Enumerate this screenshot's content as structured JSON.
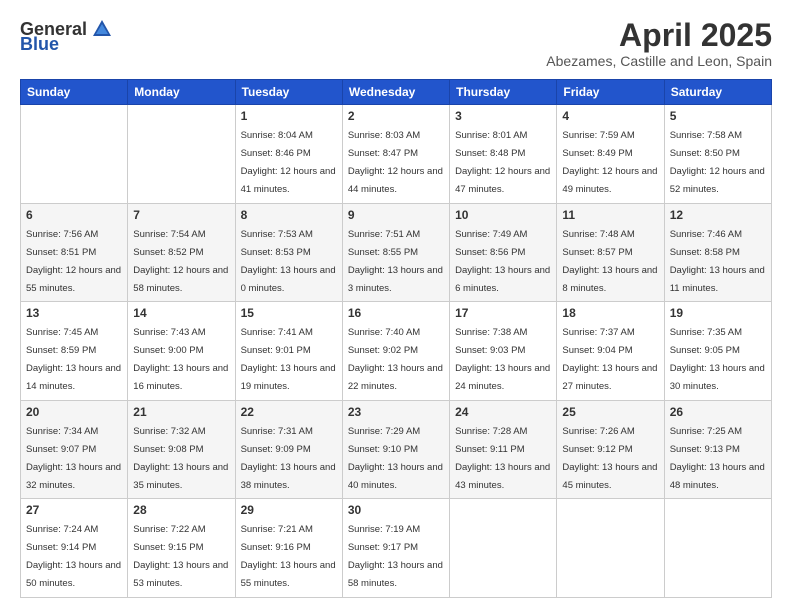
{
  "header": {
    "logo_general": "General",
    "logo_blue": "Blue",
    "month_title": "April 2025",
    "location": "Abezames, Castille and Leon, Spain"
  },
  "weekdays": [
    "Sunday",
    "Monday",
    "Tuesday",
    "Wednesday",
    "Thursday",
    "Friday",
    "Saturday"
  ],
  "weeks": [
    [
      {
        "day": "",
        "sunrise": "",
        "sunset": "",
        "daylight": ""
      },
      {
        "day": "",
        "sunrise": "",
        "sunset": "",
        "daylight": ""
      },
      {
        "day": "1",
        "sunrise": "Sunrise: 8:04 AM",
        "sunset": "Sunset: 8:46 PM",
        "daylight": "Daylight: 12 hours and 41 minutes."
      },
      {
        "day": "2",
        "sunrise": "Sunrise: 8:03 AM",
        "sunset": "Sunset: 8:47 PM",
        "daylight": "Daylight: 12 hours and 44 minutes."
      },
      {
        "day": "3",
        "sunrise": "Sunrise: 8:01 AM",
        "sunset": "Sunset: 8:48 PM",
        "daylight": "Daylight: 12 hours and 47 minutes."
      },
      {
        "day": "4",
        "sunrise": "Sunrise: 7:59 AM",
        "sunset": "Sunset: 8:49 PM",
        "daylight": "Daylight: 12 hours and 49 minutes."
      },
      {
        "day": "5",
        "sunrise": "Sunrise: 7:58 AM",
        "sunset": "Sunset: 8:50 PM",
        "daylight": "Daylight: 12 hours and 52 minutes."
      }
    ],
    [
      {
        "day": "6",
        "sunrise": "Sunrise: 7:56 AM",
        "sunset": "Sunset: 8:51 PM",
        "daylight": "Daylight: 12 hours and 55 minutes."
      },
      {
        "day": "7",
        "sunrise": "Sunrise: 7:54 AM",
        "sunset": "Sunset: 8:52 PM",
        "daylight": "Daylight: 12 hours and 58 minutes."
      },
      {
        "day": "8",
        "sunrise": "Sunrise: 7:53 AM",
        "sunset": "Sunset: 8:53 PM",
        "daylight": "Daylight: 13 hours and 0 minutes."
      },
      {
        "day": "9",
        "sunrise": "Sunrise: 7:51 AM",
        "sunset": "Sunset: 8:55 PM",
        "daylight": "Daylight: 13 hours and 3 minutes."
      },
      {
        "day": "10",
        "sunrise": "Sunrise: 7:49 AM",
        "sunset": "Sunset: 8:56 PM",
        "daylight": "Daylight: 13 hours and 6 minutes."
      },
      {
        "day": "11",
        "sunrise": "Sunrise: 7:48 AM",
        "sunset": "Sunset: 8:57 PM",
        "daylight": "Daylight: 13 hours and 8 minutes."
      },
      {
        "day": "12",
        "sunrise": "Sunrise: 7:46 AM",
        "sunset": "Sunset: 8:58 PM",
        "daylight": "Daylight: 13 hours and 11 minutes."
      }
    ],
    [
      {
        "day": "13",
        "sunrise": "Sunrise: 7:45 AM",
        "sunset": "Sunset: 8:59 PM",
        "daylight": "Daylight: 13 hours and 14 minutes."
      },
      {
        "day": "14",
        "sunrise": "Sunrise: 7:43 AM",
        "sunset": "Sunset: 9:00 PM",
        "daylight": "Daylight: 13 hours and 16 minutes."
      },
      {
        "day": "15",
        "sunrise": "Sunrise: 7:41 AM",
        "sunset": "Sunset: 9:01 PM",
        "daylight": "Daylight: 13 hours and 19 minutes."
      },
      {
        "day": "16",
        "sunrise": "Sunrise: 7:40 AM",
        "sunset": "Sunset: 9:02 PM",
        "daylight": "Daylight: 13 hours and 22 minutes."
      },
      {
        "day": "17",
        "sunrise": "Sunrise: 7:38 AM",
        "sunset": "Sunset: 9:03 PM",
        "daylight": "Daylight: 13 hours and 24 minutes."
      },
      {
        "day": "18",
        "sunrise": "Sunrise: 7:37 AM",
        "sunset": "Sunset: 9:04 PM",
        "daylight": "Daylight: 13 hours and 27 minutes."
      },
      {
        "day": "19",
        "sunrise": "Sunrise: 7:35 AM",
        "sunset": "Sunset: 9:05 PM",
        "daylight": "Daylight: 13 hours and 30 minutes."
      }
    ],
    [
      {
        "day": "20",
        "sunrise": "Sunrise: 7:34 AM",
        "sunset": "Sunset: 9:07 PM",
        "daylight": "Daylight: 13 hours and 32 minutes."
      },
      {
        "day": "21",
        "sunrise": "Sunrise: 7:32 AM",
        "sunset": "Sunset: 9:08 PM",
        "daylight": "Daylight: 13 hours and 35 minutes."
      },
      {
        "day": "22",
        "sunrise": "Sunrise: 7:31 AM",
        "sunset": "Sunset: 9:09 PM",
        "daylight": "Daylight: 13 hours and 38 minutes."
      },
      {
        "day": "23",
        "sunrise": "Sunrise: 7:29 AM",
        "sunset": "Sunset: 9:10 PM",
        "daylight": "Daylight: 13 hours and 40 minutes."
      },
      {
        "day": "24",
        "sunrise": "Sunrise: 7:28 AM",
        "sunset": "Sunset: 9:11 PM",
        "daylight": "Daylight: 13 hours and 43 minutes."
      },
      {
        "day": "25",
        "sunrise": "Sunrise: 7:26 AM",
        "sunset": "Sunset: 9:12 PM",
        "daylight": "Daylight: 13 hours and 45 minutes."
      },
      {
        "day": "26",
        "sunrise": "Sunrise: 7:25 AM",
        "sunset": "Sunset: 9:13 PM",
        "daylight": "Daylight: 13 hours and 48 minutes."
      }
    ],
    [
      {
        "day": "27",
        "sunrise": "Sunrise: 7:24 AM",
        "sunset": "Sunset: 9:14 PM",
        "daylight": "Daylight: 13 hours and 50 minutes."
      },
      {
        "day": "28",
        "sunrise": "Sunrise: 7:22 AM",
        "sunset": "Sunset: 9:15 PM",
        "daylight": "Daylight: 13 hours and 53 minutes."
      },
      {
        "day": "29",
        "sunrise": "Sunrise: 7:21 AM",
        "sunset": "Sunset: 9:16 PM",
        "daylight": "Daylight: 13 hours and 55 minutes."
      },
      {
        "day": "30",
        "sunrise": "Sunrise: 7:19 AM",
        "sunset": "Sunset: 9:17 PM",
        "daylight": "Daylight: 13 hours and 58 minutes."
      },
      {
        "day": "",
        "sunrise": "",
        "sunset": "",
        "daylight": ""
      },
      {
        "day": "",
        "sunrise": "",
        "sunset": "",
        "daylight": ""
      },
      {
        "day": "",
        "sunrise": "",
        "sunset": "",
        "daylight": ""
      }
    ]
  ]
}
